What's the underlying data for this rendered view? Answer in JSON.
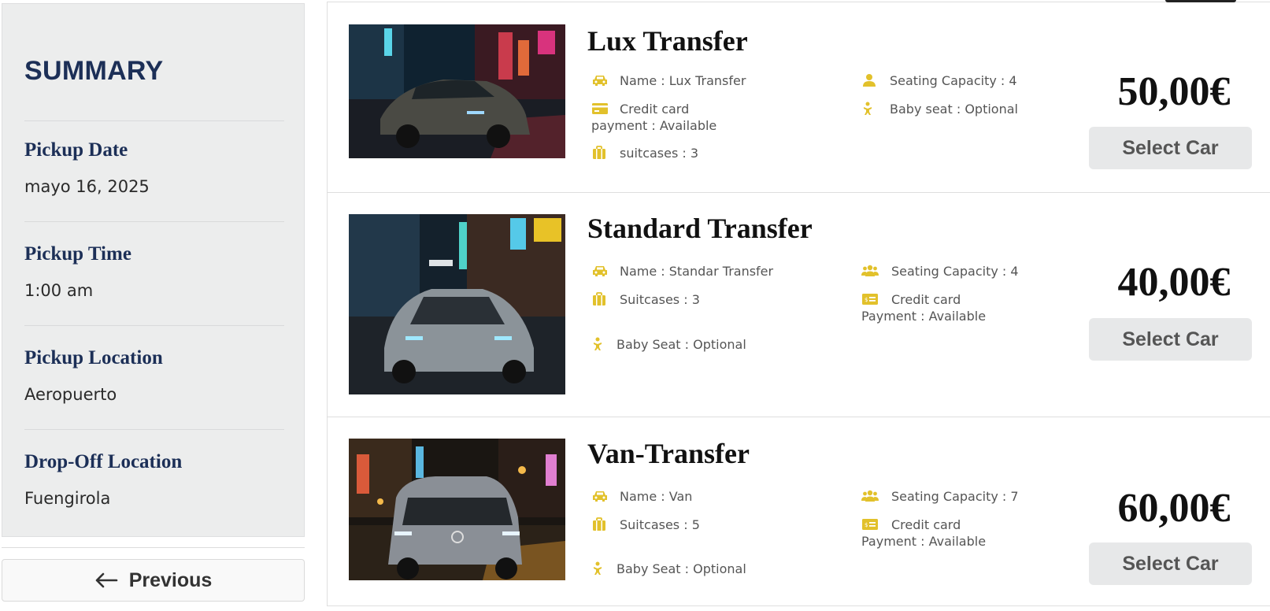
{
  "summary": {
    "title": "SUMMARY",
    "pickup_date_label": "Pickup Date",
    "pickup_date_value": "mayo 16, 2025",
    "pickup_time_label": "Pickup Time",
    "pickup_time_value": "1:00 am",
    "pickup_location_label": "Pickup Location",
    "pickup_location_value": "Aeropuerto",
    "dropoff_location_label": "Drop-Off Location",
    "dropoff_location_value": "Fuengirola"
  },
  "nav": {
    "previous_label": "Previous"
  },
  "accent_color": "#e2c12b",
  "title_color": "#1c2f57",
  "cars": [
    {
      "name": "Lux Transfer",
      "feature_name": "Name : Lux Transfer",
      "feature_payment_1": "Credit card",
      "feature_payment_2": "payment : Available",
      "feature_suitcases": "suitcases : 3",
      "feature_seats": "Seating Capacity : 4",
      "feature_baby": "Baby seat : Optional",
      "price": "50,00€",
      "button": "Select Car"
    },
    {
      "name": "Standard Transfer",
      "feature_name": "Name : Standar Transfer",
      "feature_suitcases": "Suitcases : 3",
      "feature_baby": "Baby Seat : Optional",
      "feature_seats": "Seating Capacity : 4",
      "feature_payment_1": "Credit card",
      "feature_payment_2": "Payment : Available",
      "price": "40,00€",
      "button": "Select Car"
    },
    {
      "name": "Van-Transfer",
      "feature_name": "Name : Van",
      "feature_suitcases": "Suitcases : 5",
      "feature_baby": "Baby Seat : Optional",
      "feature_seats": "Seating Capacity : 7",
      "feature_payment_1": "Credit card",
      "feature_payment_2": "Payment : Available",
      "price": "60,00€",
      "button": "Select Car"
    }
  ]
}
